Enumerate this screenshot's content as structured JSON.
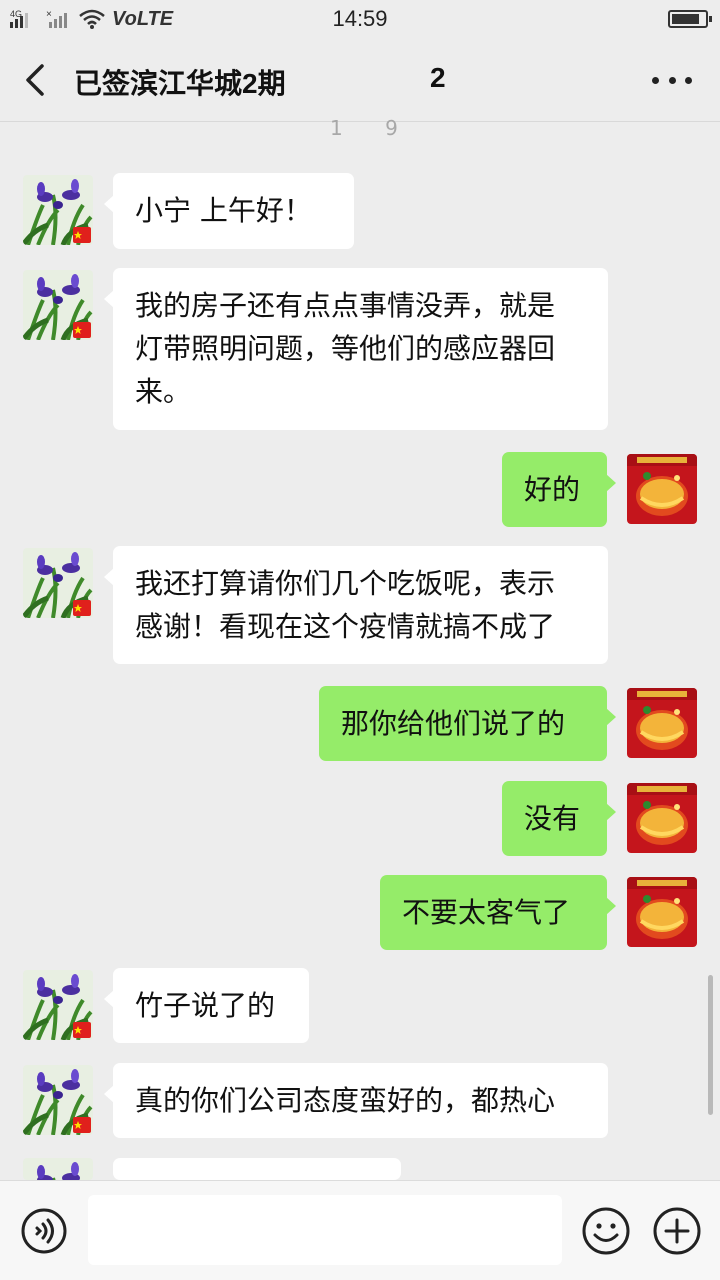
{
  "status_bar": {
    "network": "4G",
    "volte": "VoLTE",
    "time": "14:59",
    "battery_level": 0.85
  },
  "header": {
    "title": "已签滨江华城2期",
    "title_suffix": "2"
  },
  "time_hint": "1 9",
  "messages": [
    {
      "side": "left",
      "lines": [
        "小宁  上午好！"
      ]
    },
    {
      "side": "left",
      "lines": [
        "我的房子还有点点事情没弄，就是",
        "灯带照明问题，等他们的感应器回",
        "来。"
      ]
    },
    {
      "side": "right",
      "lines": [
        "好的"
      ]
    },
    {
      "side": "left",
      "lines": [
        "我还打算请你们几个吃饭呢，表示",
        "感谢！看现在这个疫情就搞不成了"
      ]
    },
    {
      "side": "right",
      "lines": [
        "那你给他们说了的"
      ]
    },
    {
      "side": "right",
      "lines": [
        "没有"
      ]
    },
    {
      "side": "right",
      "lines": [
        "不要太客气了"
      ]
    },
    {
      "side": "left",
      "lines": [
        "竹子说了的"
      ]
    },
    {
      "side": "left",
      "lines": [
        "真的你们公司态度蛮好的，都热心"
      ]
    }
  ],
  "input": {
    "placeholder": ""
  },
  "colors": {
    "background": "#ededed",
    "bubble_self": "#95ec69",
    "bubble_other": "#ffffff"
  },
  "icons": {
    "back": "chevron-left-icon",
    "more": "more-dots-icon",
    "voice": "voice-icon",
    "emoji": "emoji-icon",
    "plus": "plus-icon"
  }
}
